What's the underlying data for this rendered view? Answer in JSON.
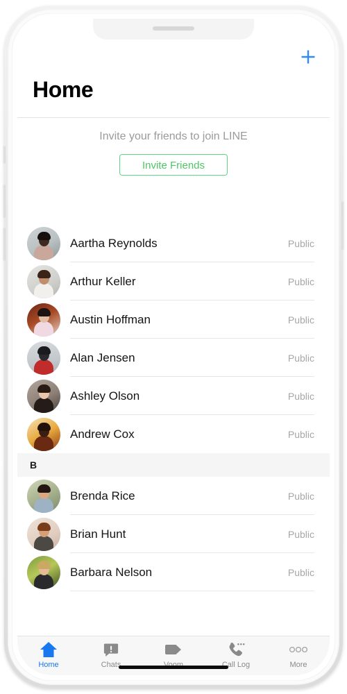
{
  "app": {
    "name": "LINE",
    "accent_blue": "#1878f0",
    "accent_green": "#4cc764",
    "meta_gray": "#a6a6a6"
  },
  "header": {
    "title": "Home",
    "add_icon": "plus-icon"
  },
  "invite": {
    "text": "Invite your friends to join LINE",
    "button_label": "Invite Friends"
  },
  "sections": [
    {
      "letter": "",
      "contacts": [
        {
          "name": "Aartha Reynolds",
          "status": "Public",
          "avatar": "portrait-dark-light-bg"
        },
        {
          "name": "Arthur Keller",
          "status": "Public",
          "avatar": "portrait-white-shirt"
        },
        {
          "name": "Austin Hoffman",
          "status": "Public",
          "avatar": "portrait-warm-red"
        },
        {
          "name": "Alan Jensen",
          "status": "Public",
          "avatar": "portrait-hiker-gray"
        },
        {
          "name": "Ashley Olson",
          "status": "Public",
          "avatar": "portrait-dark-hair"
        },
        {
          "name": "Andrew Cox",
          "status": "Public",
          "avatar": "portrait-sunset-amber"
        }
      ]
    },
    {
      "letter": "B",
      "contacts": [
        {
          "name": "Brenda Rice",
          "status": "Public",
          "avatar": "portrait-outdoor-blue"
        },
        {
          "name": "Brian Hunt",
          "status": "Public",
          "avatar": "portrait-beard-warm"
        },
        {
          "name": "Barbara Nelson",
          "status": "Public",
          "avatar": "portrait-green-foliage"
        }
      ]
    }
  ],
  "tabbar": {
    "items": [
      {
        "label": "Home",
        "icon": "home-icon",
        "active": true
      },
      {
        "label": "Chats",
        "icon": "chat-bubble-alert-icon",
        "active": false
      },
      {
        "label": "Voom",
        "icon": "tag-icon",
        "active": false
      },
      {
        "label": "Call Log",
        "icon": "phone-dots-icon",
        "active": false
      },
      {
        "label": "More",
        "icon": "more-circles-icon",
        "active": false
      }
    ]
  }
}
